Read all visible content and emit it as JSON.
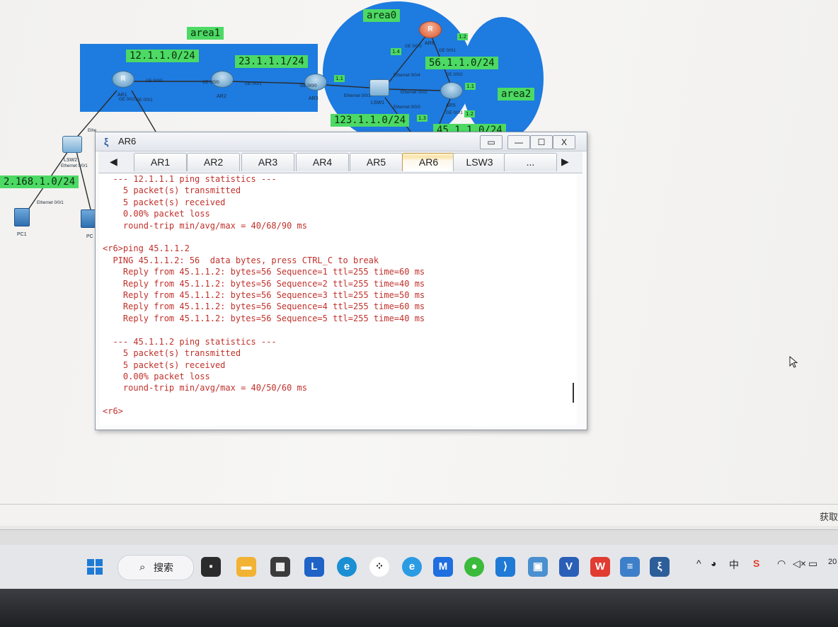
{
  "topology": {
    "areas": {
      "area1": "area1",
      "area0": "area0",
      "area2": "area2"
    },
    "networks": {
      "n12": "12.1.1.0/24",
      "n23": "23.1.1.1/24",
      "n56": "56.1.1.0/24",
      "n123": "123.1.1.0/24",
      "n45": "45.1.1.0/24",
      "n192": "2.168.1.0/24"
    },
    "tags": {
      "t12": "1.2",
      "t14": "1.4",
      "t11a": "1.1",
      "t11b": "1.1",
      "t13": "1.3",
      "t12b": "1.2"
    },
    "devices": {
      "ar1": "AR1",
      "ar2": "AR2",
      "ar3": "AR3",
      "ar5": "AR5",
      "ar6": "AR6",
      "lsw1": "LSW1",
      "lsw2": "LSW2",
      "pc1": "PC1",
      "pc2": "PC"
    },
    "router_glyph": "R",
    "ports": {
      "ar1_ge000": "GE 0/0/0",
      "ar1_ge002": "GE 0/0/2",
      "ar1_ge001": "GE 0/0/1",
      "ar2_ge000": "GE 0/0/0",
      "ar2_ge001": "GE 0/0/1",
      "ar3_ge000": "GE 0/0/0",
      "lsw1_e001": "Ethernet 0/0/1",
      "lsw1_e002": "Ethernet 0/0/2",
      "lsw1_e003": "Ethernet 0/0/3",
      "lsw1_e004": "Ethernet 0/0/4",
      "ar6_ge000": "GE 0/0/0",
      "ar6_ge001": "GE 0/0/1",
      "ar5_ge001": "GE 0/0/1",
      "ar5_ge002": "GE 0/0/2",
      "ar5_ge000": "GE 0/0/0",
      "lsw2_e001": "Ethernet 0/0/1",
      "lsw2_eth": "Ethe",
      "pc1_e001": "Ethernet 0/0/1"
    },
    "colors": {
      "area": "#1e7be0",
      "label": "#4cd964"
    }
  },
  "window": {
    "title": "AR6",
    "icon": "ensp-app-icon",
    "controls": {
      "restore": "restore-icon",
      "minimize": "—",
      "maximize": "☐",
      "close": "X"
    },
    "tabs": [
      "AR1",
      "AR2",
      "AR3",
      "AR4",
      "AR5",
      "AR6",
      "LSW3",
      "..."
    ],
    "active_tab": "AR6",
    "terminal_color": "#c0312b",
    "terminal": [
      "  --- 12.1.1.1 ping statistics ---",
      "    5 packet(s) transmitted",
      "    5 packet(s) received",
      "    0.00% packet loss",
      "    round-trip min/avg/max = 40/68/90 ms",
      "",
      "<r6>ping 45.1.1.2",
      "  PING 45.1.1.2: 56  data bytes, press CTRL_C to break",
      "    Reply from 45.1.1.2: bytes=56 Sequence=1 ttl=255 time=60 ms",
      "    Reply from 45.1.1.2: bytes=56 Sequence=2 ttl=255 time=40 ms",
      "    Reply from 45.1.1.2: bytes=56 Sequence=3 ttl=255 time=50 ms",
      "    Reply from 45.1.1.2: bytes=56 Sequence=4 ttl=255 time=60 ms",
      "    Reply from 45.1.1.2: bytes=56 Sequence=5 ttl=255 time=40 ms",
      "",
      "  --- 45.1.1.2 ping statistics ---",
      "    5 packet(s) transmitted",
      "    5 packet(s) received",
      "    0.00% packet loss",
      "    round-trip min/avg/max = 40/50/60 ms",
      "",
      "<r6>"
    ]
  },
  "statusbar": {
    "right_text": "获取"
  },
  "taskbar": {
    "search_label": "搜索",
    "icons": [
      "windows-start-icon",
      "task-view-icon",
      "file-explorer-icon",
      "microsoft-store-icon",
      "lenovo-icon",
      "edge-icon",
      "app-dots-icon",
      "ie-icon",
      "tencent-meeting-icon",
      "wechat-icon",
      "vscode-icon",
      "remote-desktop-icon",
      "vc-icon",
      "wps-icon",
      "notepad-icon",
      "ensp-icon"
    ],
    "tray": {
      "chevron": "^",
      "clock_partial": "20"
    }
  }
}
